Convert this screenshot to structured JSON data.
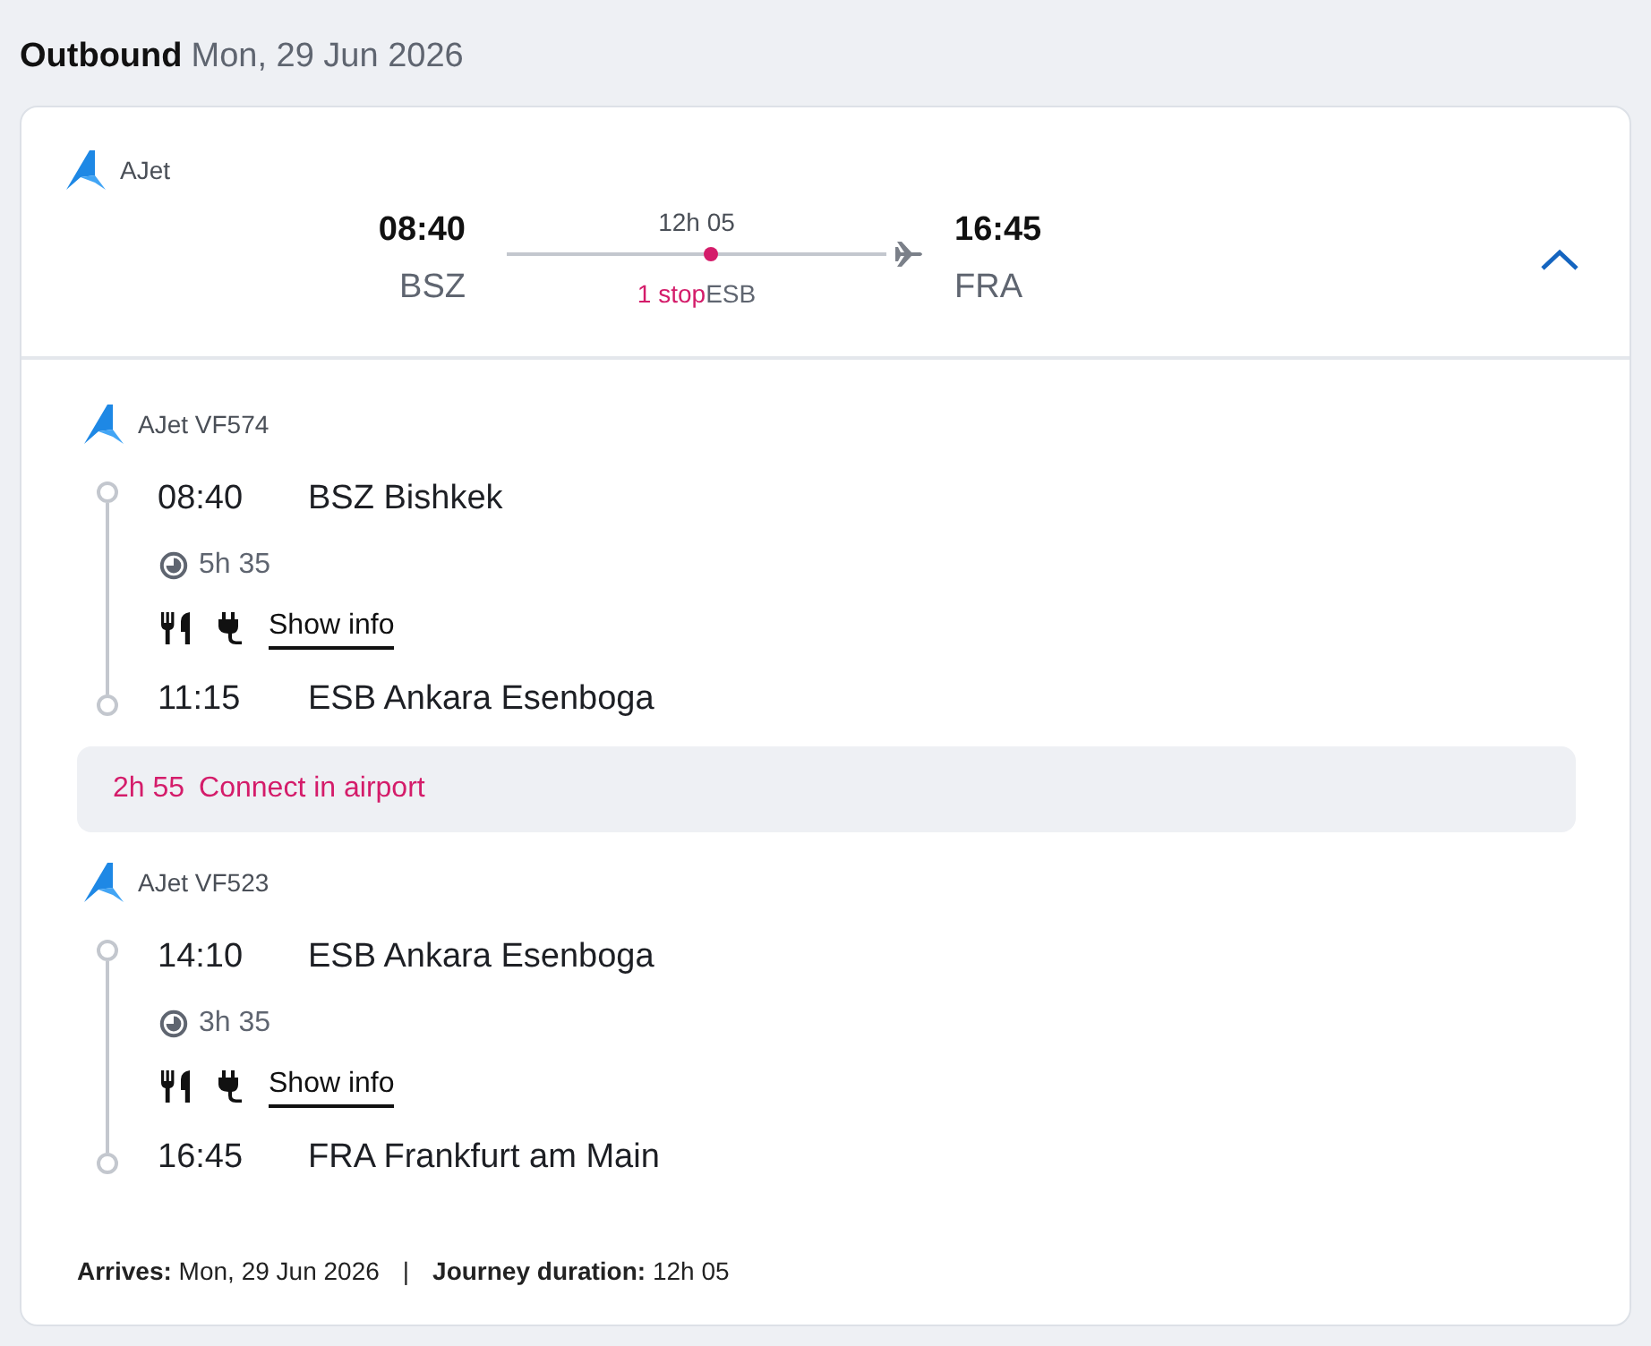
{
  "heading": {
    "title": "Outbound",
    "date": "Mon, 29 Jun 2026"
  },
  "summary": {
    "airline": "AJet",
    "depart_time": "08:40",
    "depart_code": "BSZ",
    "duration": "12h 05",
    "stops": "1 stop",
    "stop_code": "ESB",
    "arrive_time": "16:45",
    "arrive_code": "FRA",
    "expanded": true
  },
  "itinerary": [
    {
      "kind": "flight",
      "airline": "AJet VF574",
      "departure": {
        "time": "08:40",
        "airport": "BSZ Bishkek"
      },
      "duration": "5h 35",
      "info_link": "Show info",
      "arrival": {
        "time": "11:15",
        "airport": "ESB Ankara Esenboga"
      }
    },
    {
      "kind": "connection",
      "duration": "2h 55",
      "label": "Connect in airport"
    },
    {
      "kind": "flight",
      "airline": "AJet VF523",
      "departure": {
        "time": "14:10",
        "airport": "ESB Ankara Esenboga"
      },
      "duration": "3h 35",
      "info_link": "Show info",
      "arrival": {
        "time": "16:45",
        "airport": "FRA Frankfurt am Main"
      }
    }
  ],
  "footer": {
    "arrives": "**Arrives:** Mon, 29 Jun 2026",
    "separator": "|",
    "journey": "**Journey duration:** 12h 05"
  }
}
